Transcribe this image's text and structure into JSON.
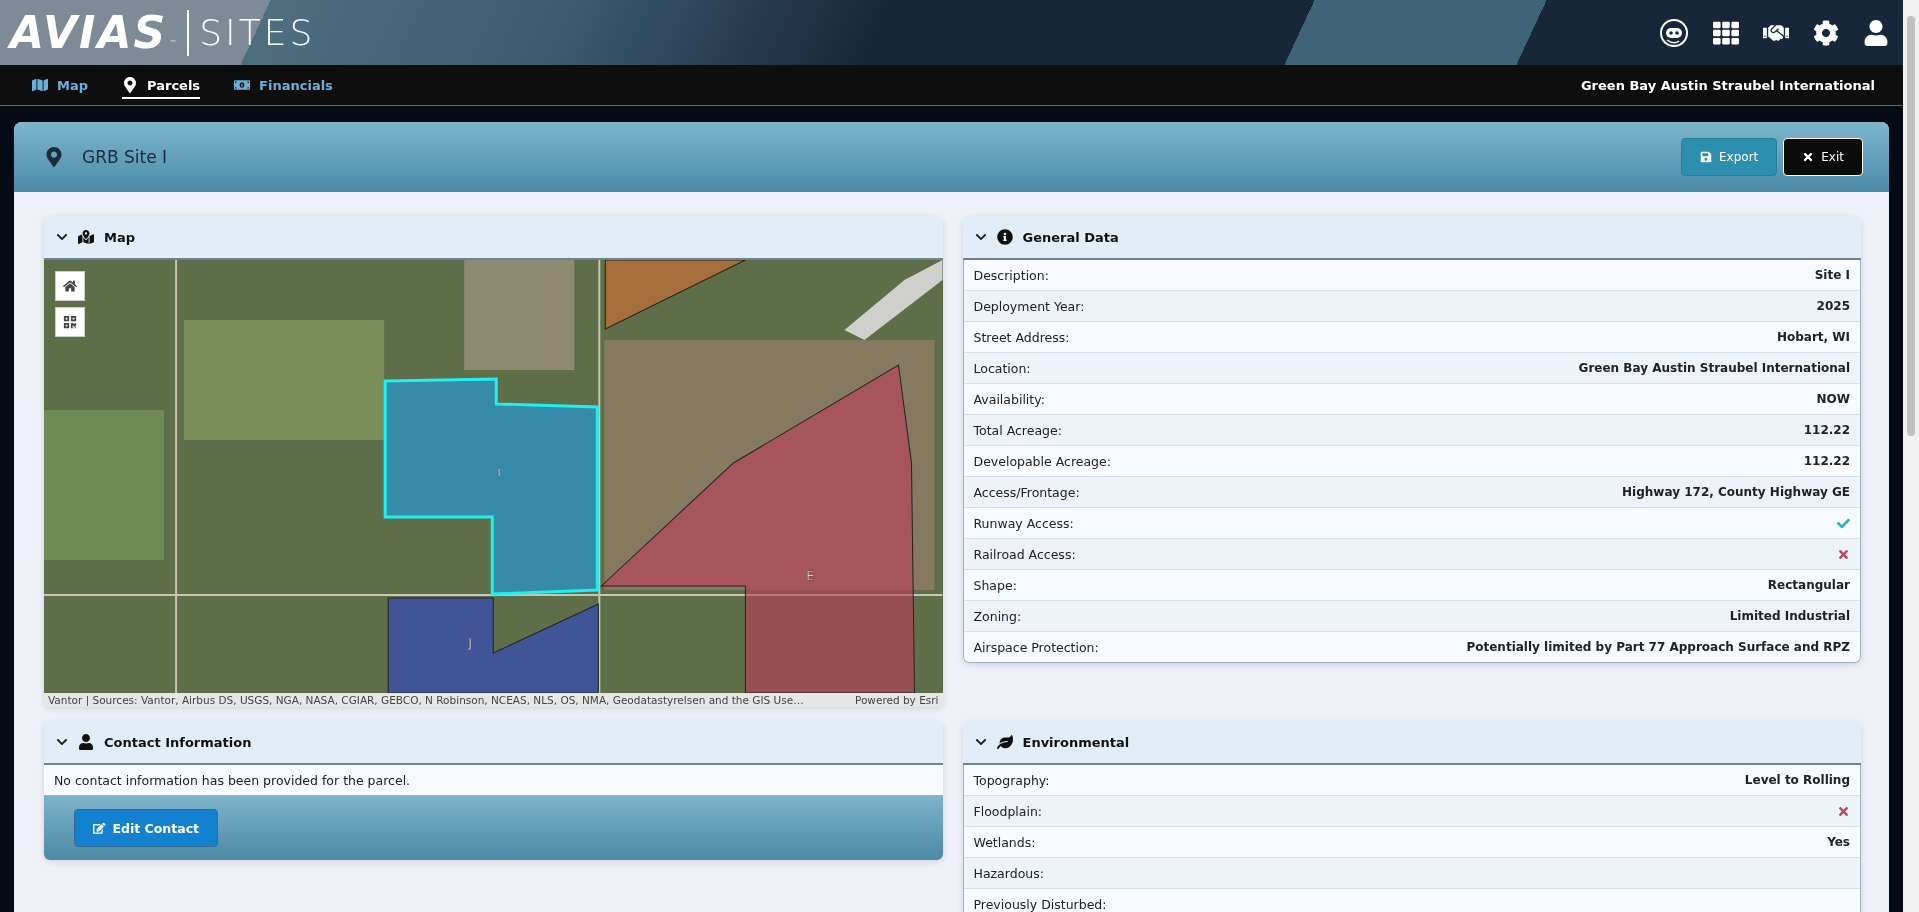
{
  "header": {
    "logo": "AVIAS",
    "trademark": "™",
    "product": "SITES"
  },
  "nav": {
    "tabs": [
      {
        "label": "Map",
        "selected": false
      },
      {
        "label": "Parcels",
        "selected": true
      },
      {
        "label": "Financials",
        "selected": false
      }
    ],
    "airport": "Green Bay Austin Straubel International"
  },
  "page": {
    "title": "GRB Site I",
    "buttons": [
      {
        "label": "Export",
        "kind": "export"
      },
      {
        "label": "Exit",
        "kind": "exit"
      }
    ]
  },
  "map_panel": {
    "title": "Map",
    "expanded": true,
    "parcels": [
      {
        "label": "I",
        "kind": "selected"
      },
      {
        "label": "E",
        "kind": "other"
      },
      {
        "label": "J",
        "kind": "neighbor"
      }
    ],
    "attribution": "Vantor | Sources: Vantor, Airbus DS, USGS, NGA, NASA, CGIAR, GEBCO, N Robinson, NCEAS, NLS, OS, NMA, Geodatastyrelsen and the GIS Use…",
    "powered_by": "Powered by Esri"
  },
  "general_data": {
    "title": "General Data",
    "expanded": true,
    "rows": [
      {
        "label": "Description:",
        "kind": "text",
        "value": "Site I"
      },
      {
        "label": "Deployment Year:",
        "kind": "text",
        "value": "2025"
      },
      {
        "label": "Street Address:",
        "kind": "text",
        "value": "Hobart, WI"
      },
      {
        "label": "Location:",
        "kind": "text",
        "value": "Green Bay Austin Straubel International"
      },
      {
        "label": "Availability:",
        "kind": "text",
        "value": "NOW"
      },
      {
        "label": "Total Acreage:",
        "kind": "text",
        "value": "112.22"
      },
      {
        "label": "Developable Acreage:",
        "kind": "text",
        "value": "112.22"
      },
      {
        "label": "Access/Frontage:",
        "kind": "text",
        "value": "Highway 172, County Highway GE"
      },
      {
        "label": "Runway Access:",
        "kind": "check"
      },
      {
        "label": "Railroad Access:",
        "kind": "cross"
      },
      {
        "label": "Shape:",
        "kind": "text",
        "value": "Rectangular"
      },
      {
        "label": "Zoning:",
        "kind": "text",
        "value": "Limited Industrial"
      },
      {
        "label": "Airspace Protection:",
        "kind": "text",
        "value": "Potentially limited by Part 77 Approach Surface and RPZ"
      }
    ]
  },
  "contact": {
    "title": "Contact Information",
    "expanded": true,
    "message": "No contact information has been provided for the parcel.",
    "button": "Edit Contact"
  },
  "environmental": {
    "title": "Environmental",
    "expanded": true,
    "rows": [
      {
        "label": "Topography:",
        "kind": "text",
        "value": "Level to Rolling"
      },
      {
        "label": "Floodplain:",
        "kind": "cross"
      },
      {
        "label": "Wetlands:",
        "kind": "text",
        "value": "Yes"
      },
      {
        "label": "Hazardous:",
        "kind": "empty"
      },
      {
        "label": "Previously Disturbed:",
        "kind": "empty"
      }
    ]
  }
}
